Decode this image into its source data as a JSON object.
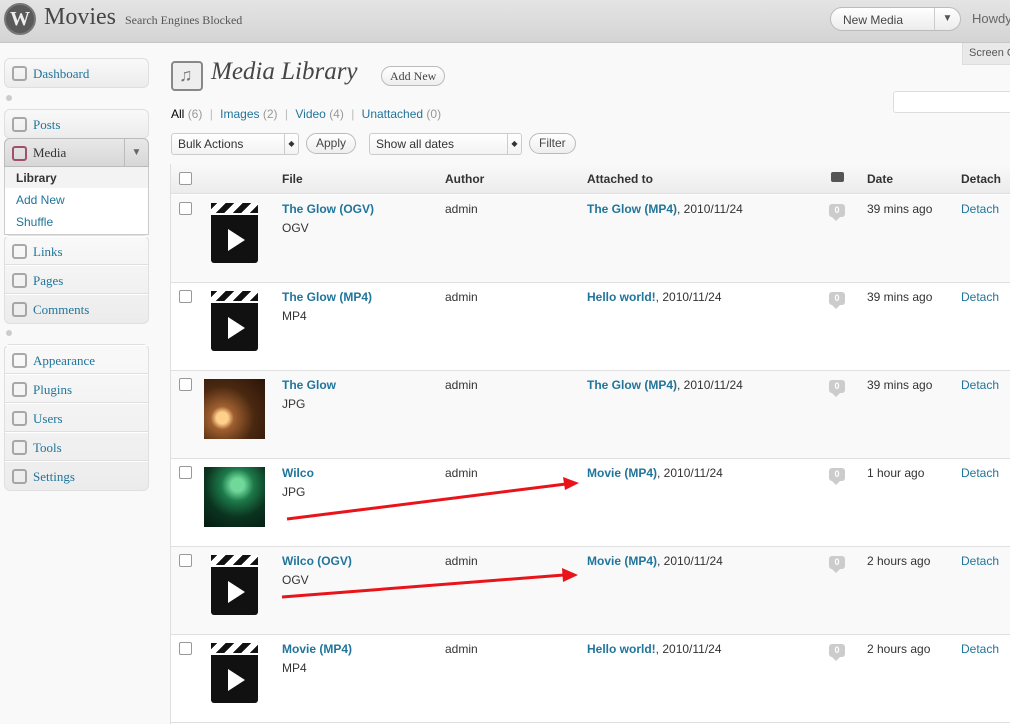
{
  "header": {
    "site_title": "Movies",
    "site_visibility": "Search Engines Blocked",
    "favorite_action": "New Media",
    "howdy": "Howdy",
    "screen_options": "Screen O"
  },
  "menu": {
    "dashboard": "Dashboard",
    "posts": "Posts",
    "media": "Media",
    "media_submenu": [
      "Library",
      "Add New",
      "Shuffle"
    ],
    "links": "Links",
    "pages": "Pages",
    "comments": "Comments",
    "appearance": "Appearance",
    "plugins": "Plugins",
    "users": "Users",
    "tools": "Tools",
    "settings": "Settings"
  },
  "page": {
    "title": "Media Library",
    "add_new": "Add New"
  },
  "filters": [
    {
      "label": "All",
      "count": "(6)"
    },
    {
      "label": "Images",
      "count": "(2)"
    },
    {
      "label": "Video",
      "count": "(4)"
    },
    {
      "label": "Unattached",
      "count": "(0)"
    }
  ],
  "actions": {
    "bulk_actions": "Bulk Actions",
    "apply": "Apply",
    "show_all_dates": "Show all dates",
    "filter": "Filter"
  },
  "table": {
    "columns": {
      "file": "File",
      "author": "Author",
      "attached_to": "Attached to",
      "date": "Date",
      "detach": "Detach"
    },
    "rows": [
      {
        "title": "The Glow (OGV)",
        "ext": "OGV",
        "author": "admin",
        "attached_link": "The Glow (MP4)",
        "attached_date": ", 2010/11/24",
        "comments": "0",
        "date": "39 mins ago",
        "detach": "Detach",
        "thumb": "clapperboard"
      },
      {
        "title": "The Glow (MP4)",
        "ext": "MP4",
        "author": "admin",
        "attached_link": "Hello world!",
        "attached_date": ", 2010/11/24",
        "comments": "0",
        "date": "39 mins ago",
        "detach": "Detach",
        "thumb": "clapperboard"
      },
      {
        "title": "The Glow",
        "ext": "JPG",
        "author": "admin",
        "attached_link": "The Glow (MP4)",
        "attached_date": ", 2010/11/24",
        "comments": "0",
        "date": "39 mins ago",
        "detach": "Detach",
        "thumb": "photo-glow"
      },
      {
        "title": "Wilco",
        "ext": "JPG",
        "author": "admin",
        "attached_link": "Movie (MP4)",
        "attached_date": ", 2010/11/24",
        "comments": "0",
        "date": "1 hour ago",
        "detach": "Detach",
        "thumb": "photo-wilco"
      },
      {
        "title": "Wilco (OGV)",
        "ext": "OGV",
        "author": "admin",
        "attached_link": "Movie (MP4)",
        "attached_date": ", 2010/11/24",
        "comments": "0",
        "date": "2 hours ago",
        "detach": "Detach",
        "thumb": "clapperboard"
      },
      {
        "title": "Movie (MP4)",
        "ext": "MP4",
        "author": "admin",
        "attached_link": "Hello world!",
        "attached_date": ", 2010/11/24",
        "comments": "0",
        "date": "2 hours ago",
        "detach": "Detach",
        "thumb": "clapperboard"
      }
    ]
  },
  "colors": {
    "link": "#21759b",
    "annotation_arrow": "#e8141a"
  }
}
